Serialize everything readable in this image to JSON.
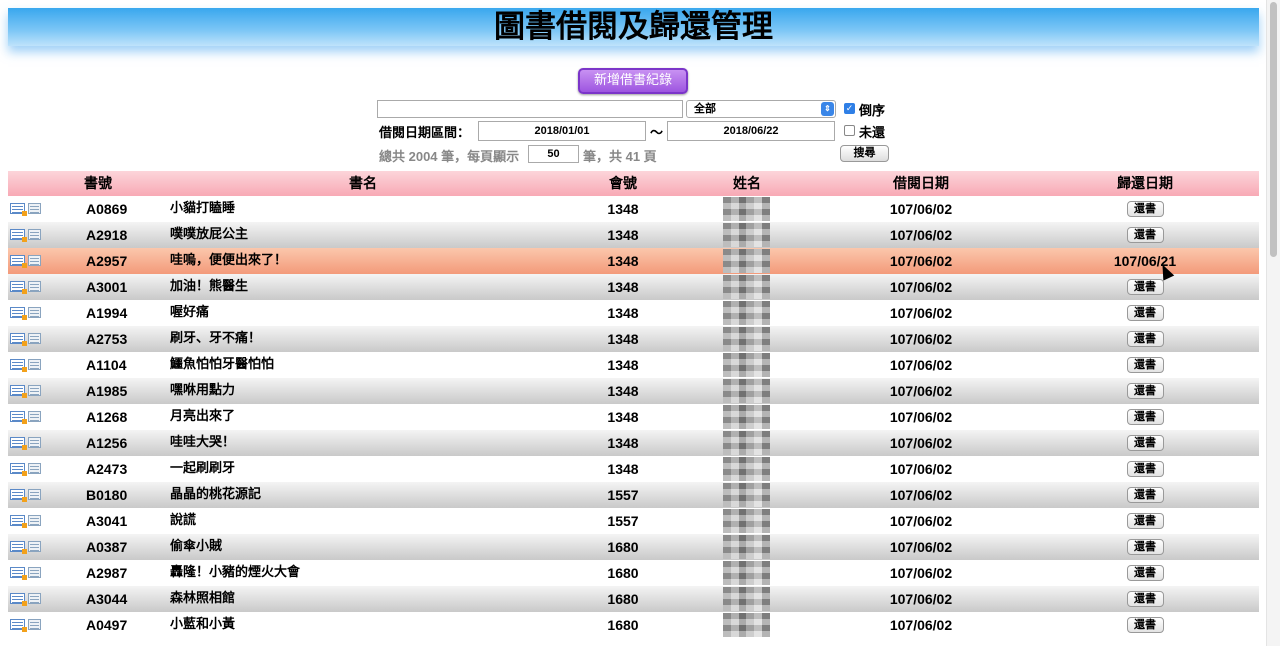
{
  "title": "圖書借閱及歸還管理",
  "add_button": "新增借書紀錄",
  "filter": {
    "keyword_value": "",
    "category_selected": "全部",
    "reverse_label": "倒序",
    "reverse_checked": true,
    "date_range_label": "借閱日期區間：",
    "date_from": "2018/01/01",
    "date_sep": "～",
    "date_to": "2018/06/22",
    "unreturned_label": "未還",
    "unreturned_checked": false,
    "summary_prefix": "總共 2004 筆，每頁顯示",
    "per_page": "50",
    "summary_suffix": "筆，共 41 頁",
    "search_button": "搜尋"
  },
  "table": {
    "headers": [
      "書號",
      "書名",
      "會號",
      "姓名",
      "借閱日期",
      "歸還日期"
    ],
    "return_button_label": "還書",
    "rows": [
      {
        "id": "A0869",
        "name": "小貓打瞌睡",
        "member": "1348",
        "borrow": "107/06/02",
        "returned": ""
      },
      {
        "id": "A2918",
        "name": "噗噗放屁公主",
        "member": "1348",
        "borrow": "107/06/02",
        "returned": ""
      },
      {
        "id": "A2957",
        "name": "哇嗚，便便出來了！",
        "member": "1348",
        "borrow": "107/06/02",
        "returned": "107/06/21"
      },
      {
        "id": "A3001",
        "name": "加油！熊醫生",
        "member": "1348",
        "borrow": "107/06/02",
        "returned": ""
      },
      {
        "id": "A1994",
        "name": "喔好痛",
        "member": "1348",
        "borrow": "107/06/02",
        "returned": ""
      },
      {
        "id": "A2753",
        "name": "刷牙、牙不痛！",
        "member": "1348",
        "borrow": "107/06/02",
        "returned": ""
      },
      {
        "id": "A1104",
        "name": "鱷魚怕怕牙醫怕怕",
        "member": "1348",
        "borrow": "107/06/02",
        "returned": ""
      },
      {
        "id": "A1985",
        "name": "嘿咻用點力",
        "member": "1348",
        "borrow": "107/06/02",
        "returned": ""
      },
      {
        "id": "A1268",
        "name": "月亮出來了",
        "member": "1348",
        "borrow": "107/06/02",
        "returned": ""
      },
      {
        "id": "A1256",
        "name": "哇哇大哭！",
        "member": "1348",
        "borrow": "107/06/02",
        "returned": ""
      },
      {
        "id": "A2473",
        "name": "一起刷刷牙",
        "member": "1348",
        "borrow": "107/06/02",
        "returned": ""
      },
      {
        "id": "B0180",
        "name": "晶晶的桃花源記",
        "member": "1557",
        "borrow": "107/06/02",
        "returned": ""
      },
      {
        "id": "A3041",
        "name": "說謊",
        "member": "1557",
        "borrow": "107/06/02",
        "returned": ""
      },
      {
        "id": "A0387",
        "name": "偷傘小賊",
        "member": "1680",
        "borrow": "107/06/02",
        "returned": ""
      },
      {
        "id": "A2987",
        "name": "轟隆！小豬的煙火大會",
        "member": "1680",
        "borrow": "107/06/02",
        "returned": ""
      },
      {
        "id": "A3044",
        "name": "森林照相館",
        "member": "1680",
        "borrow": "107/06/02",
        "returned": ""
      },
      {
        "id": "A0497",
        "name": "小藍和小黃",
        "member": "1680",
        "borrow": "107/06/02",
        "returned": ""
      }
    ]
  },
  "colors": {
    "banner": "#39a7ee",
    "add_button": "#9d55e0",
    "header_row": "#f8a9b5",
    "highlight_row": "#f39a7a"
  },
  "icons": [
    "edit-record-icon",
    "detail-table-icon"
  ]
}
